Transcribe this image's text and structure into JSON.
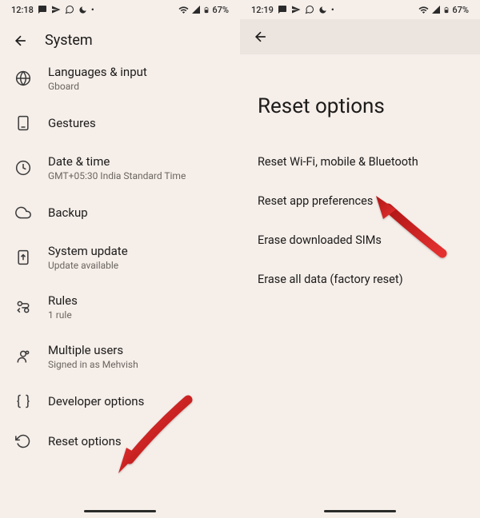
{
  "left": {
    "status": {
      "time": "12:18",
      "battery": "67%"
    },
    "header": {
      "title": "System"
    },
    "items": [
      {
        "title": "Languages & input",
        "sub": "Gboard"
      },
      {
        "title": "Gestures",
        "sub": ""
      },
      {
        "title": "Date & time",
        "sub": "GMT+05:30 India Standard Time"
      },
      {
        "title": "Backup",
        "sub": ""
      },
      {
        "title": "System update",
        "sub": "Update available"
      },
      {
        "title": "Rules",
        "sub": "1 rule"
      },
      {
        "title": "Multiple users",
        "sub": "Signed in as Mehvish"
      },
      {
        "title": "Developer options",
        "sub": ""
      },
      {
        "title": "Reset options",
        "sub": ""
      }
    ]
  },
  "right": {
    "status": {
      "time": "12:19",
      "battery": "67%"
    },
    "title": "Reset options",
    "items": [
      {
        "title": "Reset Wi-Fi, mobile & Bluetooth"
      },
      {
        "title": "Reset app preferences"
      },
      {
        "title": "Erase downloaded SIMs"
      },
      {
        "title": "Erase all data (factory reset)"
      }
    ]
  }
}
